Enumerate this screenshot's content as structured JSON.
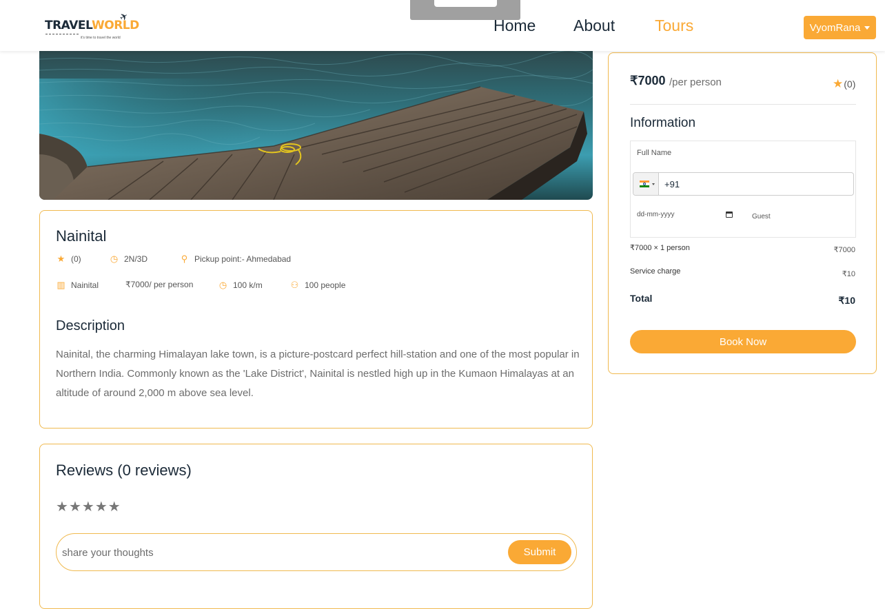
{
  "header": {
    "logo_text_1": "TRAVEL",
    "logo_text_2": "WORLD",
    "logo_tagline": "it's time to travel the world",
    "nav": [
      {
        "label": "Home"
      },
      {
        "label": "About"
      },
      {
        "label": "Tours"
      }
    ],
    "user_label": "VyomRana"
  },
  "tour": {
    "title": "Nainital",
    "rating": "(0)",
    "duration": "2N/3D",
    "pickup": "Pickup point:- Ahmedabad",
    "city": "Nainital",
    "price_per_person": "₹7000/ per person",
    "distance": "100 k/m",
    "max_group": "100 people",
    "description_title": "Description",
    "description": "Nainital, the charming Himalayan lake town, is a picture-postcard perfect hill-station and one of the most popular in Northern India. Commonly known as the 'Lake District', Nainital is nestled high up in the Kumaon Himalayas at an altitude of around 2,000 m above sea level."
  },
  "reviews": {
    "title": "Reviews (0 reviews)",
    "stars": [
      "★",
      "★",
      "★",
      "★",
      "★"
    ],
    "placeholder": "share your thoughts",
    "submit_label": "Submit"
  },
  "booking": {
    "price": "₹7000",
    "per_label": "/per person",
    "rating": "(0)",
    "info_title": "Information",
    "full_name_placeholder": "Full Name",
    "phone_value": "+91",
    "date_placeholder": "dd-mm-yyyy",
    "guest_placeholder": "Guest",
    "line1_label": "₹7000  × 1 person",
    "line1_value": "₹7000",
    "service_label": "Service charge",
    "service_value": "₹10",
    "total_label": "Total",
    "total_value": "₹10",
    "book_label": "Book Now"
  },
  "colors": {
    "accent": "#faa935",
    "heading": "#1b2a38"
  }
}
